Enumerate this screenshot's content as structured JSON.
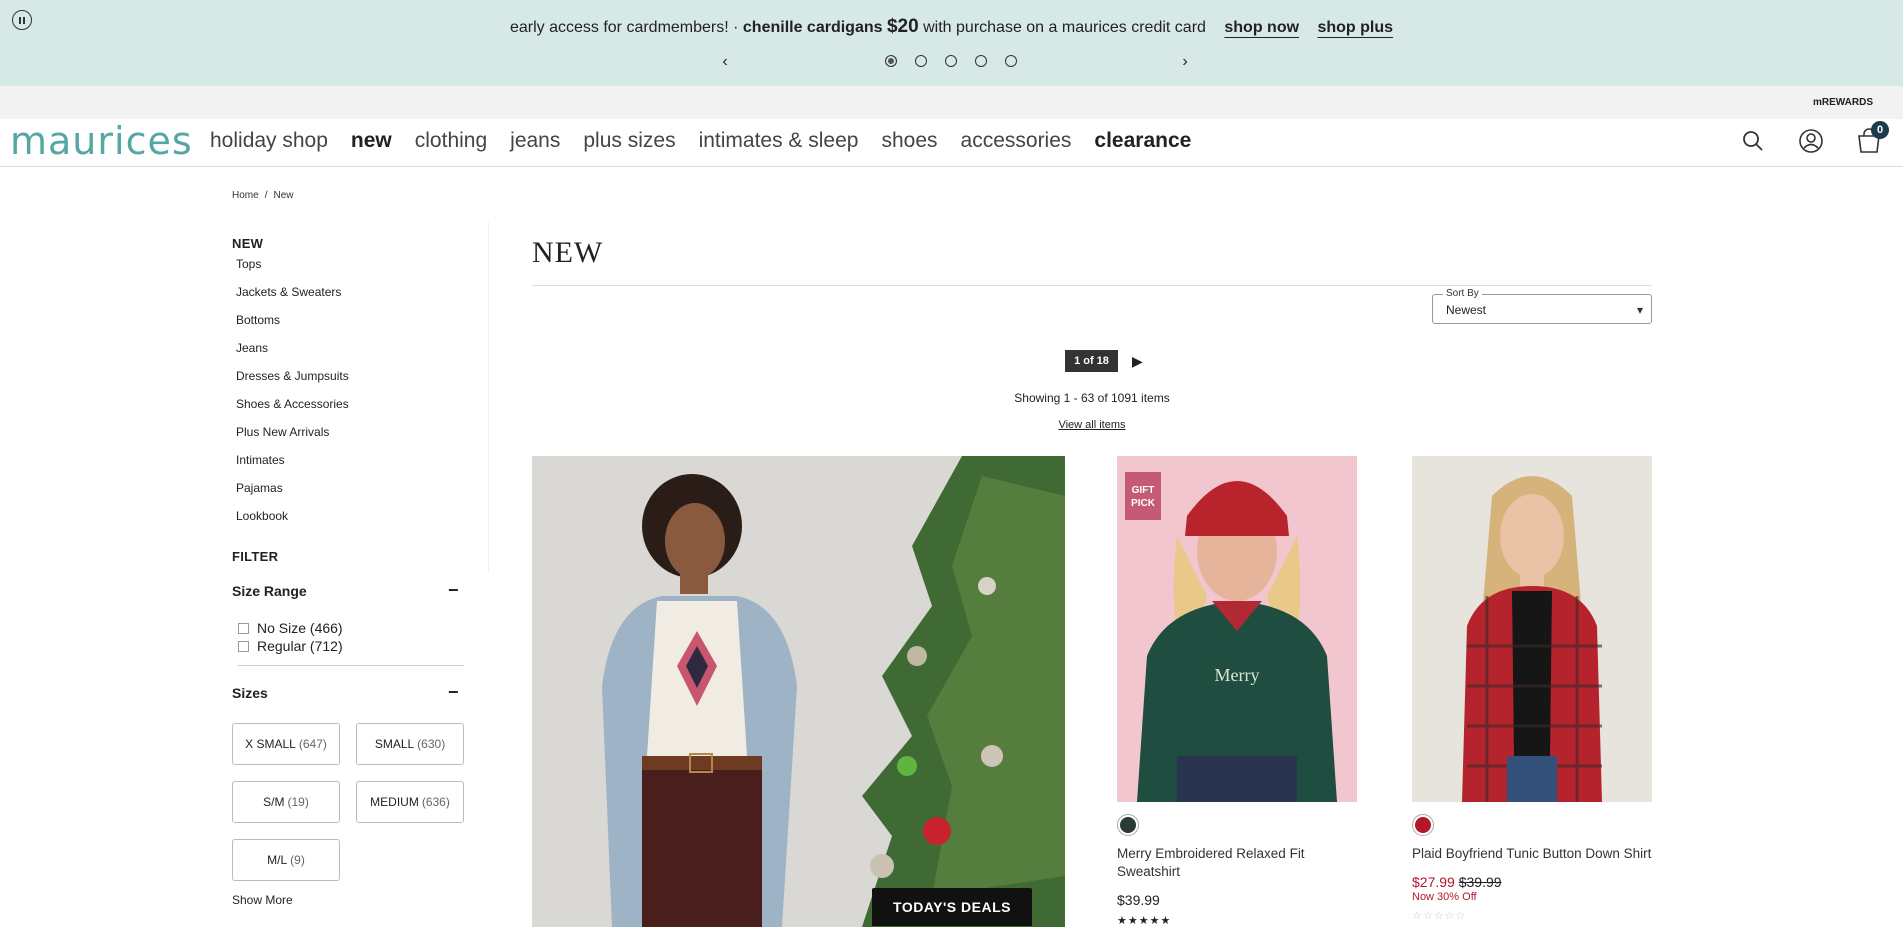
{
  "promo": {
    "text_lead": "early access for cardmembers! · ",
    "text_bold": "chenille cardigans ",
    "text_price": "$20",
    "text_tail": " with purchase on a maurices credit card",
    "link_shop_now": "shop now",
    "link_shop_plus": "shop plus",
    "prev_arrow": "‹",
    "next_arrow": "›"
  },
  "utility": {
    "rewards": "mREWARDS"
  },
  "nav": {
    "logo": "maurices",
    "items": [
      "holiday shop",
      "new",
      "clothing",
      "jeans",
      "plus sizes",
      "intimates & sleep",
      "shoes",
      "accessories",
      "clearance"
    ],
    "cart_count": "0"
  },
  "breadcrumb": {
    "home": "Home",
    "separator": "/",
    "current": "New"
  },
  "sidebar": {
    "heading": "NEW",
    "links": [
      "Tops",
      "Jackets & Sweaters",
      "Bottoms",
      "Jeans",
      "Dresses & Jumpsuits",
      "Shoes & Accessories",
      "Plus New Arrivals",
      "Intimates",
      "Pajamas",
      "Lookbook"
    ],
    "filter_heading": "FILTER",
    "size_range": {
      "title": "Size Range",
      "collapse": "−",
      "options": [
        {
          "label": "No Size (466)"
        },
        {
          "label": "Regular (712)"
        }
      ]
    },
    "sizes": {
      "title": "Sizes",
      "collapse": "−",
      "options": [
        {
          "label": "X SMALL",
          "count": "(647)"
        },
        {
          "label": "SMALL",
          "count": "(630)"
        },
        {
          "label": "S/M",
          "count": "(19)"
        },
        {
          "label": "MEDIUM",
          "count": "(636)"
        },
        {
          "label": "M/L",
          "count": "(9)"
        }
      ],
      "show_more": "Show More"
    }
  },
  "main": {
    "title": "NEW",
    "sort": {
      "label": "Sort By",
      "value": "Newest",
      "caret": "▾"
    },
    "pager": {
      "current": "1 of 18",
      "next": "▶"
    },
    "showing": "Showing 1 - 63 of 1091 items",
    "view_all": "View all items",
    "hero": {
      "button": "TODAY'S DEALS"
    },
    "products": [
      {
        "name": "Merry Embroidered Relaxed Fit Sweatshirt",
        "badge": "GIFT PICK",
        "swatch_color": "#2b3a36",
        "price": "$39.99",
        "stars": "★★★★★"
      },
      {
        "name": "Plaid Boyfriend Tunic Button Down Shirt",
        "swatch_color": "#b3172a",
        "sale_price": "$27.99",
        "orig_price": "$39.99",
        "promo_note": "Now 30% Off",
        "stars": "☆☆☆☆☆"
      }
    ]
  },
  "colors": {
    "accent_teal": "#54a7a2",
    "banner_bg": "#d7e9e6",
    "sale_red": "#b3172a"
  }
}
